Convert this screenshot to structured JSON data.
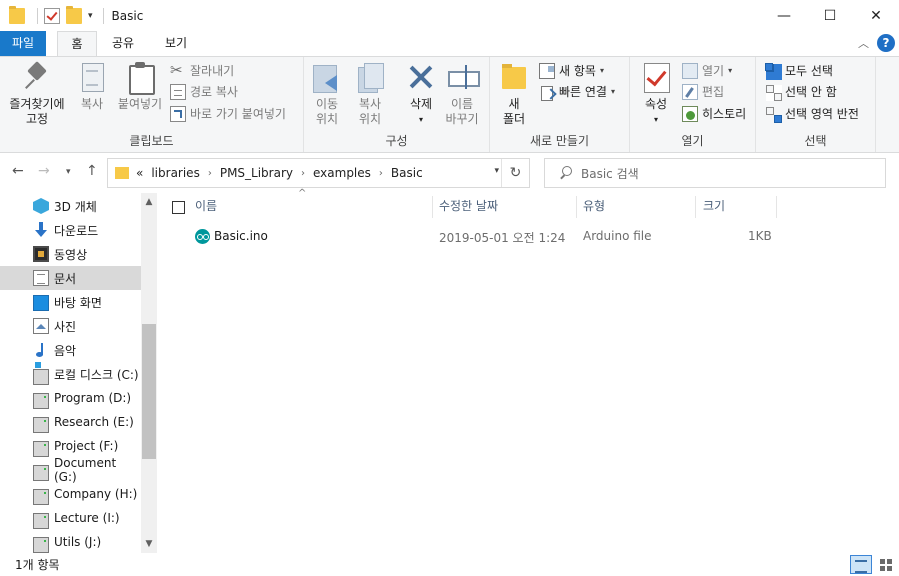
{
  "window": {
    "title": "Basic",
    "qat_dropdown": "▾",
    "controls": {
      "minimize": "—",
      "maximize": "☐",
      "close": "✕"
    }
  },
  "tabs": [
    {
      "label": "파일"
    },
    {
      "label": "홈"
    },
    {
      "label": "공유"
    },
    {
      "label": "보기"
    }
  ],
  "ribbon": {
    "clipboard": {
      "label": "클립보드",
      "pin_line1": "즐겨찾기에",
      "pin_line2": "고정",
      "copy": "복사",
      "paste": "붙여넣기",
      "cut": "잘라내기",
      "copy_path": "경로 복사",
      "paste_shortcut": "바로 가기 붙여넣기"
    },
    "organize": {
      "label": "구성",
      "move_line1": "이동",
      "move_line2": "위치",
      "copyto_line1": "복사",
      "copyto_line2": "위치",
      "delete": "삭제",
      "rename_line1": "이름",
      "rename_line2": "바꾸기"
    },
    "new": {
      "label": "새로 만들기",
      "folder_line1": "새",
      "folder_line2": "폴더",
      "new_item": "새 항목",
      "easy_access": "빠른 연결"
    },
    "open": {
      "label": "열기",
      "properties": "속성",
      "open": "열기",
      "edit": "편집",
      "history": "히스토리"
    },
    "select": {
      "label": "선택",
      "select_all": "모두 선택",
      "select_none": "선택 안 함",
      "invert": "선택 영역 반전"
    }
  },
  "address": {
    "overflow": "«",
    "crumbs": [
      "libraries",
      "PMS_Library",
      "examples",
      "Basic"
    ],
    "search_placeholder": "Basic 검색"
  },
  "sidebar": {
    "items": [
      {
        "label": "3D 개체",
        "icon": "3d-objects-icon"
      },
      {
        "label": "다운로드",
        "icon": "downloads-icon"
      },
      {
        "label": "동영상",
        "icon": "videos-icon"
      },
      {
        "label": "문서",
        "icon": "documents-icon",
        "selected": true
      },
      {
        "label": "바탕 화면",
        "icon": "desktop-icon"
      },
      {
        "label": "사진",
        "icon": "pictures-icon"
      },
      {
        "label": "음악",
        "icon": "music-icon"
      },
      {
        "label": "로컬 디스크 (C:)",
        "icon": "system-drive-icon"
      },
      {
        "label": "Program (D:)",
        "icon": "drive-icon"
      },
      {
        "label": "Research (E:)",
        "icon": "drive-icon"
      },
      {
        "label": "Project (F:)",
        "icon": "drive-icon"
      },
      {
        "label": "Document (G:)",
        "icon": "drive-icon"
      },
      {
        "label": "Company (H:)",
        "icon": "drive-icon"
      },
      {
        "label": "Lecture (I:)",
        "icon": "drive-icon"
      },
      {
        "label": "Utils (J:)",
        "icon": "drive-icon"
      }
    ]
  },
  "filelist": {
    "columns": {
      "name": "이름",
      "modified": "수정한 날짜",
      "type": "유형",
      "size": "크기"
    },
    "rows": [
      {
        "name": "Basic.ino",
        "modified": "2019-05-01 오전 1:24",
        "type": "Arduino file",
        "size": "1KB",
        "icon": "arduino-file-icon"
      }
    ]
  },
  "status": {
    "count": "1개 항목"
  },
  "colors": {
    "file_tab": "#1979ca",
    "ribbon_bg": "#f5f6f7",
    "selected_nav": "#d9d9d9",
    "arduino": "#00979c"
  }
}
